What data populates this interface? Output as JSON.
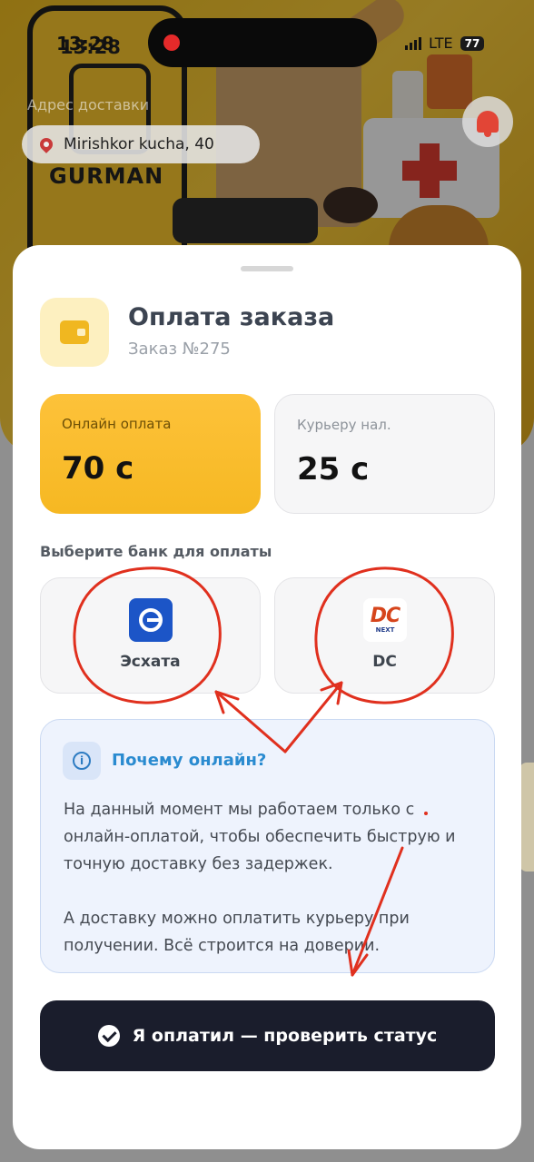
{
  "status_bar": {
    "time": "13:28",
    "network": "LTE",
    "battery": "77"
  },
  "background": {
    "phone_time": "13:28",
    "brand_text": "GURMAN"
  },
  "delivery": {
    "label": "Адрес доставки",
    "address": "Mirishkor kucha, 40"
  },
  "payment": {
    "title": "Оплата заказа",
    "order_number": "Заказ №275",
    "online": {
      "label": "Онлайн оплата",
      "amount": "70 с"
    },
    "courier": {
      "label": "Курьеру нал.",
      "amount": "25 с"
    },
    "bank_prompt": "Выберите банк для оплаты",
    "banks": [
      {
        "name": "Эсхата",
        "logo_icon": "eskhata-logo-icon"
      },
      {
        "name": "DC",
        "logo_icon": "dc-next-logo-icon",
        "logo_letters": "DC",
        "logo_sub": "NEXT"
      }
    ]
  },
  "info": {
    "title": "Почему онлайн?",
    "icon_glyph": "i",
    "paragraph_1": "На данный момент мы работаем только с онлайн-оплатой, чтобы обеспечить быструю и точную доставку без задержек.",
    "paragraph_2": "А доставку можно оплатить курьеру при получении. Всё строится на доверии."
  },
  "confirm_button": {
    "label": "Я оплатил — проверить статус"
  },
  "colors": {
    "accent_yellow": "#F6B822",
    "button_dark": "#1A1D2C",
    "info_blue": "#2A8BD0",
    "annotation_red": "#E0301E"
  }
}
